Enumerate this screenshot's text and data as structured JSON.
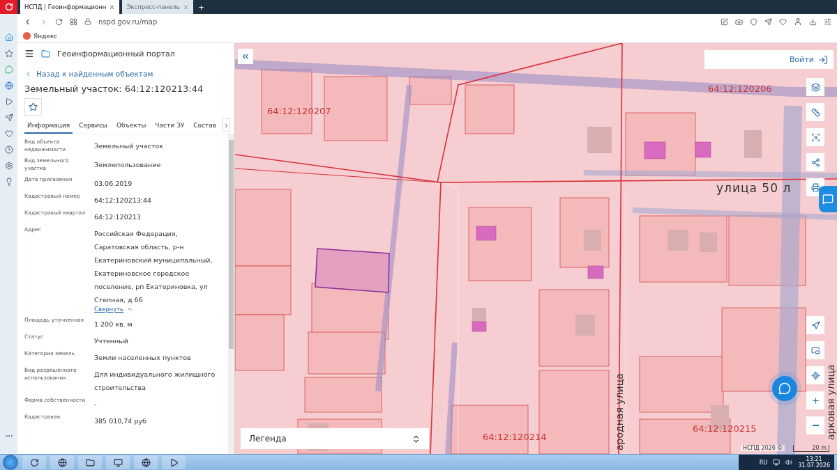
{
  "browser": {
    "tabs": [
      {
        "title": "НСПД | Геоинформационн",
        "selected": true
      },
      {
        "title": "Экспресс-панель",
        "selected": false
      }
    ],
    "new_tab": "+",
    "address": "nspd.gov.ru/map",
    "bookmarks": [
      "Яндекс"
    ]
  },
  "panel": {
    "title": "Геоинформационный портал",
    "back": "Назад к найденным объектам",
    "heading": "Земельный участок: 64:12:120213:44",
    "tabs": [
      {
        "label": "Информация",
        "selected": true
      },
      {
        "label": "Сервисы",
        "selected": false
      },
      {
        "label": "Объекты",
        "selected": false
      },
      {
        "label": "Части ЗУ",
        "selected": false
      },
      {
        "label": "Состав",
        "selected": false
      }
    ],
    "fields": [
      {
        "label": "Вид объекта недвижимости",
        "value": "Земельный участок"
      },
      {
        "label": "Вид земельного участка",
        "value": "Землепользование"
      },
      {
        "label": "Дата присвоения",
        "value": "03.06.2019"
      },
      {
        "label": "Кадастровый номер",
        "value": "64:12:120213:44"
      },
      {
        "label": "Кадастровый квартал",
        "value": "64:12:120213"
      },
      {
        "label": "Адрес",
        "value": "Российская Федерация, Саратовская область, р-н Екатериновский муниципальный, Екатериновское городское поселение, рп Екатериновка, ул Степная, д 66",
        "toggle": "Свернуть",
        "expanded": true
      },
      {
        "label": "Площадь уточненная",
        "value": "1 200 кв. м"
      },
      {
        "label": "Статус",
        "value": "Учтенный"
      },
      {
        "label": "Категория земель",
        "value": "Земли населенных пунктов"
      },
      {
        "label": "Вид разрешенного использования",
        "value": "Для индивидуального жилищного строительства"
      },
      {
        "label": "Форма собственности",
        "value": "-"
      },
      {
        "label": "Кадастровая",
        "value": "385 010,74 руб"
      }
    ]
  },
  "map": {
    "login": "Войти",
    "legend": "Легенда",
    "attribution": "НСПД 2026 ©",
    "scale": "20 m",
    "labels": [
      {
        "text": "64:12:120207",
        "kind": "parcel"
      },
      {
        "text": "64:12:120206",
        "kind": "parcel"
      },
      {
        "text": "улица 50 л",
        "kind": "street"
      },
      {
        "text": "64:12:120214",
        "kind": "parcel"
      },
      {
        "text": "64:12:120215",
        "kind": "parcel"
      },
      {
        "text": "ародная улица",
        "kind": "vstreet"
      },
      {
        "text": "арковая улица",
        "kind": "vstreet"
      }
    ]
  },
  "taskbar": {
    "language": "RU",
    "time": "13:21",
    "date": "31.07.2026"
  }
}
